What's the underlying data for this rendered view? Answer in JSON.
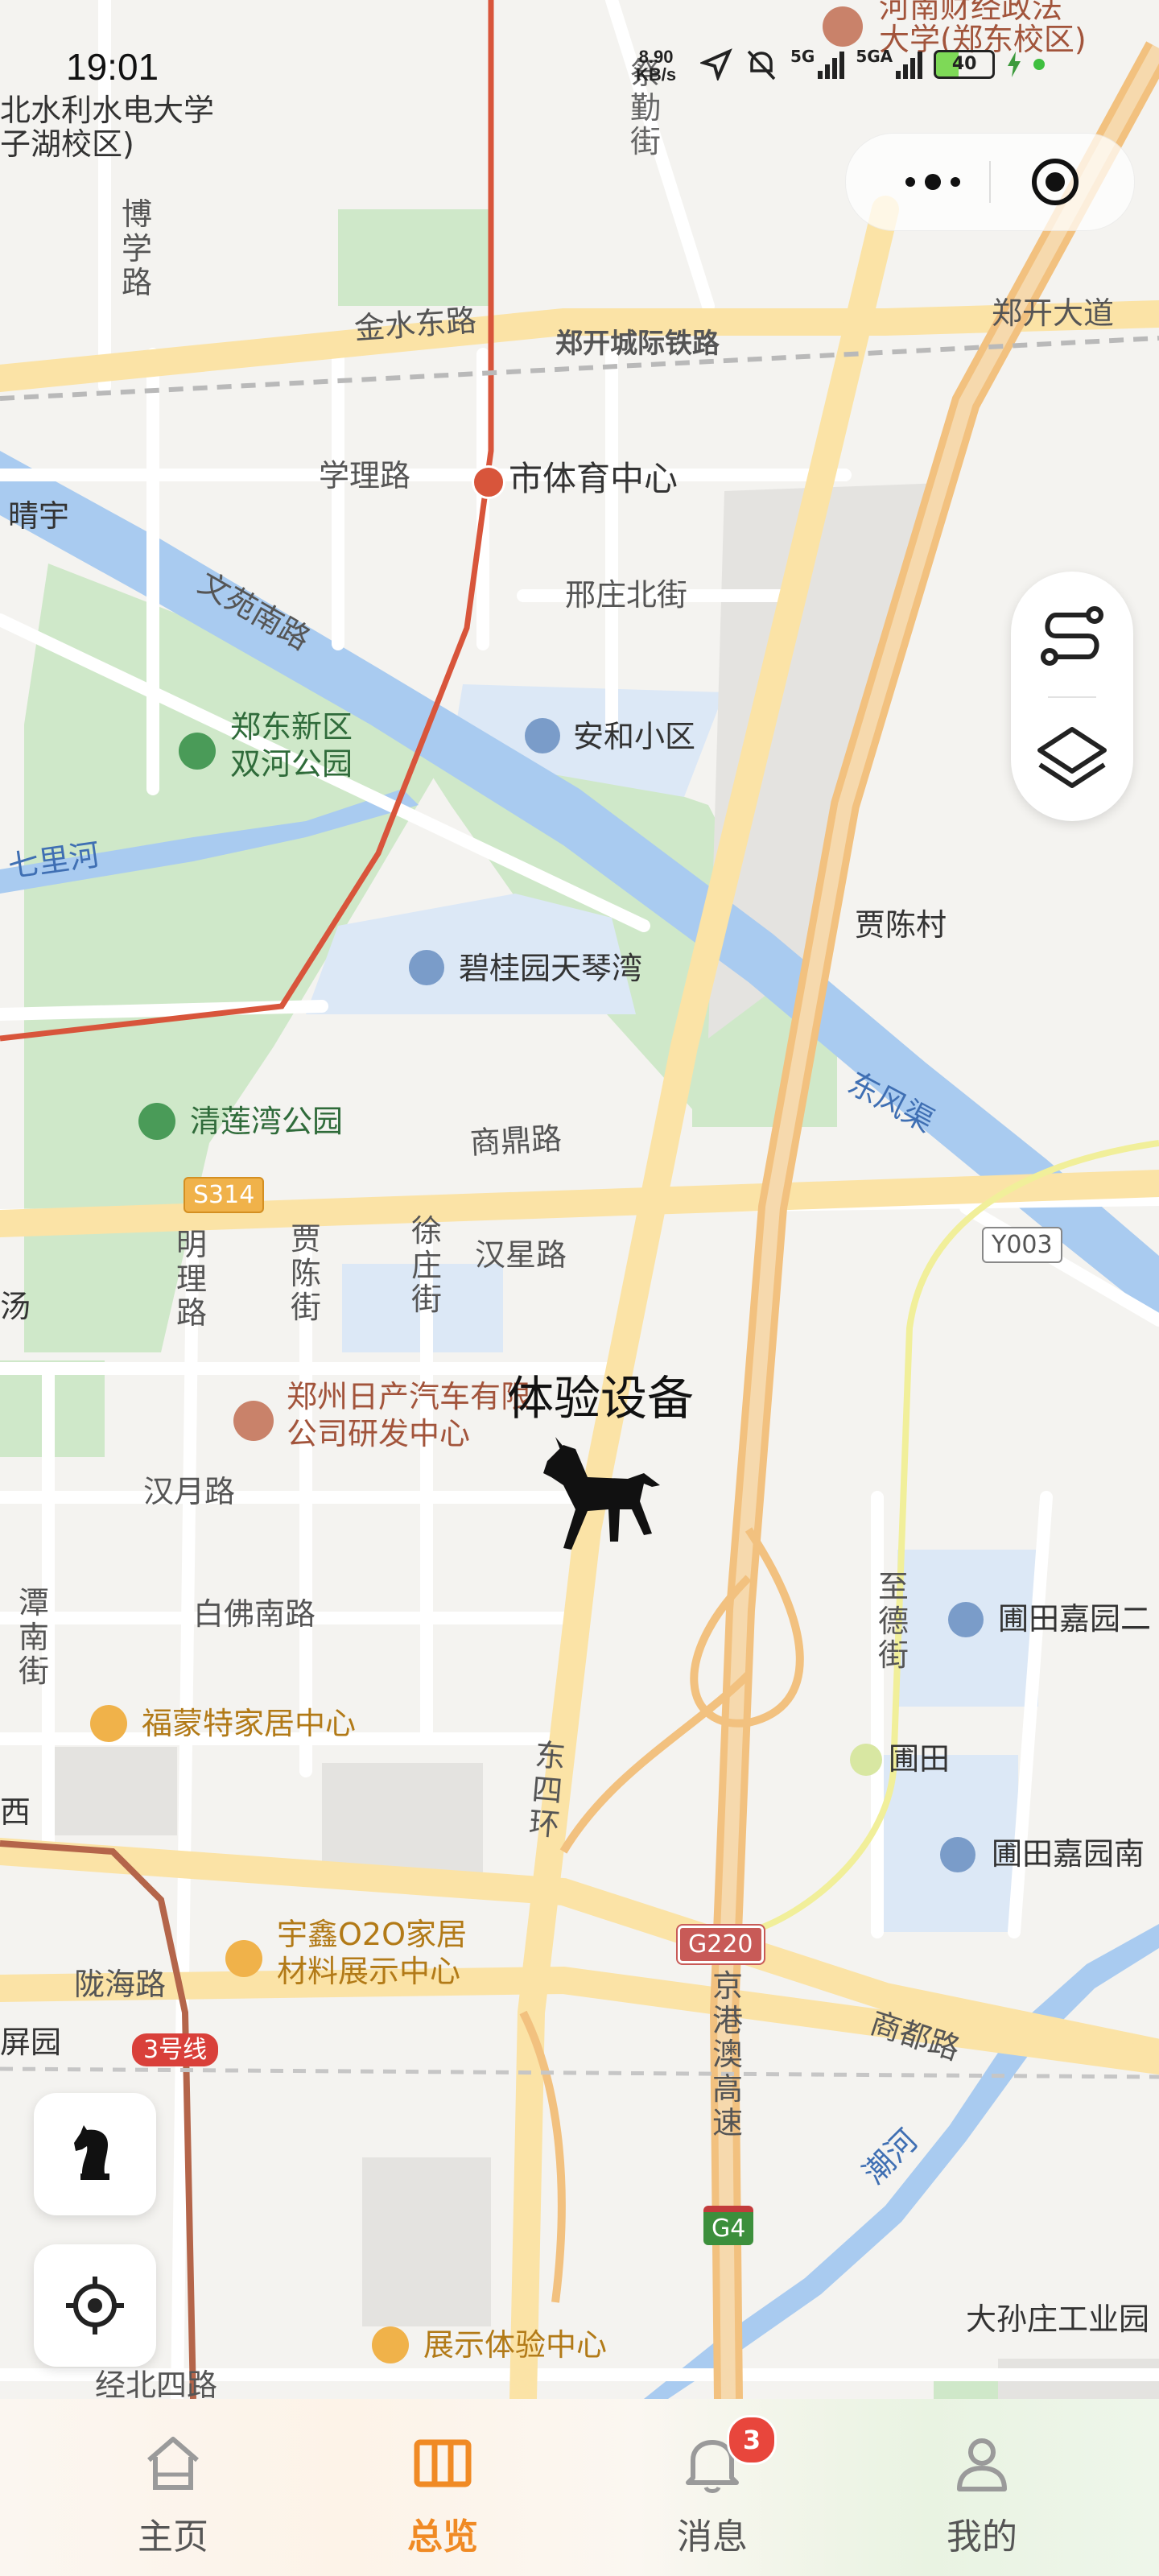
{
  "status_bar": {
    "time": "19:01",
    "net_speed": "8.90",
    "net_speed_unit": "KB/s",
    "net_1": "5G",
    "net_2": "5GA",
    "battery": "40"
  },
  "capsule": {
    "more_icon": "more-dots-icon",
    "close_icon": "target-close-icon"
  },
  "map": {
    "roads": [
      "金水东路",
      "郑开城际铁路",
      "郑开大道",
      "学理路",
      "邢庄北街",
      "文苑南路",
      "商鼎路",
      "汉星路",
      "汉月路",
      "白佛南路",
      "陇海路",
      "商都路",
      "经北四路"
    ],
    "vertical_roads": [
      "博学路",
      "祭勤街",
      "明理路",
      "贾陈街",
      "徐庄街",
      "潭南街",
      "至德街",
      "东四环",
      "京港澳高速"
    ],
    "pois": {
      "univ1": "北水利水电大学",
      "univ1b": "子湖校区)",
      "univ2": "河南财经政法",
      "univ2b": "大学(郑东校区)",
      "metro_station": "市体育中心",
      "anhe": "安和小区",
      "shuanghe_park": "郑东新区",
      "shuanghe_park2": "双河公园",
      "bigui": "碧桂园天琴湾",
      "jiachen": "贾陈村",
      "qinglian": "清莲湾公园",
      "nissan": "郑州日产汽车有限",
      "nissan2": "公司研发中心",
      "fumengte": "福蒙特家居中心",
      "putian_jiayuan1": "圃田嘉园二",
      "putian": "圃田",
      "putian_jiayuan2": "圃田嘉园南",
      "yuxin": "宇鑫O2O家居",
      "yuxin2": "材料展示中心",
      "zhanshi": "展示体验中心",
      "dasunzhuang": "大孙庄工业园",
      "qingyu": "晴宇",
      "pingyuan": "屏园",
      "xi": "西",
      "yang": "汤"
    },
    "water": [
      "七里河",
      "东风渠",
      "潮河"
    ],
    "shields": {
      "s314": "S314",
      "y003": "Y003",
      "g220": "G220",
      "g4": "G4",
      "line3": "3号线"
    },
    "device": {
      "label": "体验设备",
      "icon": "horse-icon"
    }
  },
  "right_tools": {
    "route_icon": "route-icon",
    "layers_icon": "layers-icon"
  },
  "left_tools": {
    "horse_button_icon": "chess-knight-icon",
    "locate_icon": "locate-icon"
  },
  "tabbar": {
    "tabs": [
      {
        "label": "主页",
        "icon": "home-icon"
      },
      {
        "label": "总览",
        "icon": "overview-icon"
      },
      {
        "label": "消息",
        "icon": "bell-icon",
        "badge": "3"
      },
      {
        "label": "我的",
        "icon": "user-icon"
      }
    ],
    "active_index": 1,
    "accent": "#f08a24"
  }
}
